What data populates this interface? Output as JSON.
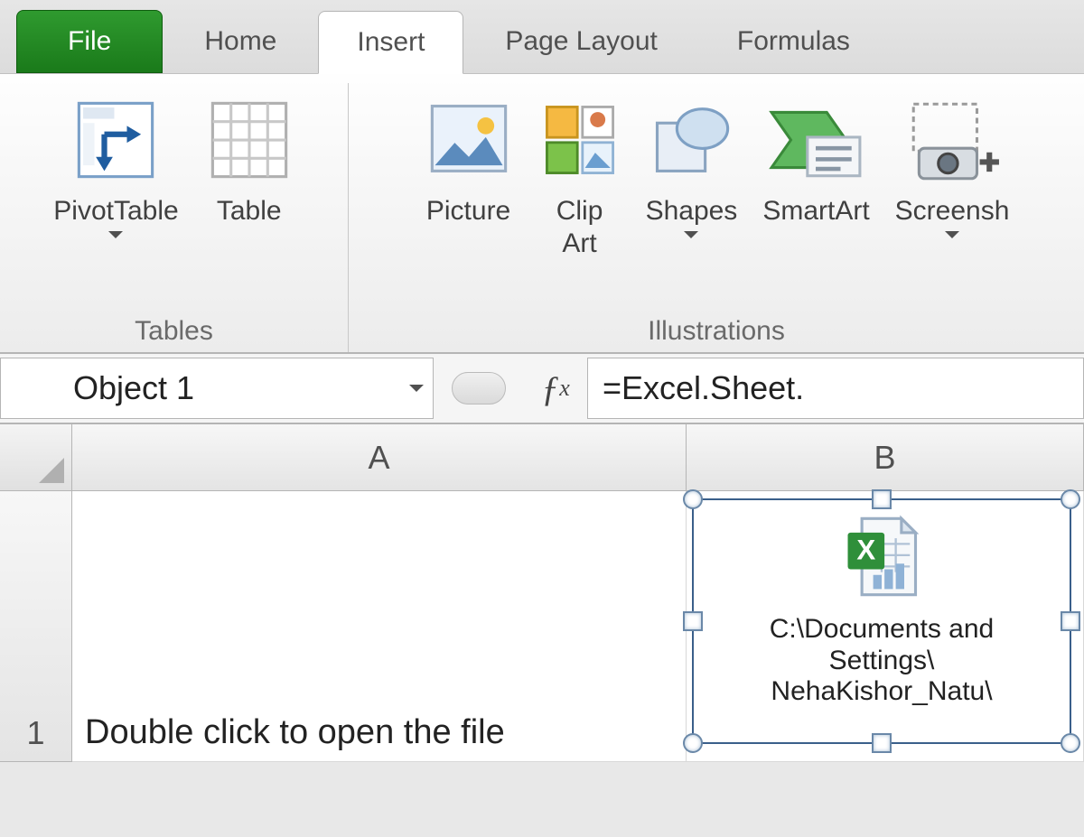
{
  "tabs": {
    "file": "File",
    "home": "Home",
    "insert": "Insert",
    "page_layout": "Page Layout",
    "formulas": "Formulas"
  },
  "ribbon": {
    "groups": {
      "tables": {
        "label": "Tables",
        "pivot": "PivotTable",
        "table": "Table"
      },
      "illustrations": {
        "label": "Illustrations",
        "picture": "Picture",
        "clipart": "Clip\nArt",
        "shapes": "Shapes",
        "smartart": "SmartArt",
        "screenshot": "Screensh"
      }
    }
  },
  "namebox": "Object 1",
  "formula": "=Excel.Sheet.",
  "columns": {
    "A": "A",
    "B": "B"
  },
  "rows": {
    "1": "1"
  },
  "cells": {
    "A1": "Double click to open the file"
  },
  "object": {
    "label": "C:\\Documents and\nSettings\\\nNehaKishor_Natu\\"
  }
}
